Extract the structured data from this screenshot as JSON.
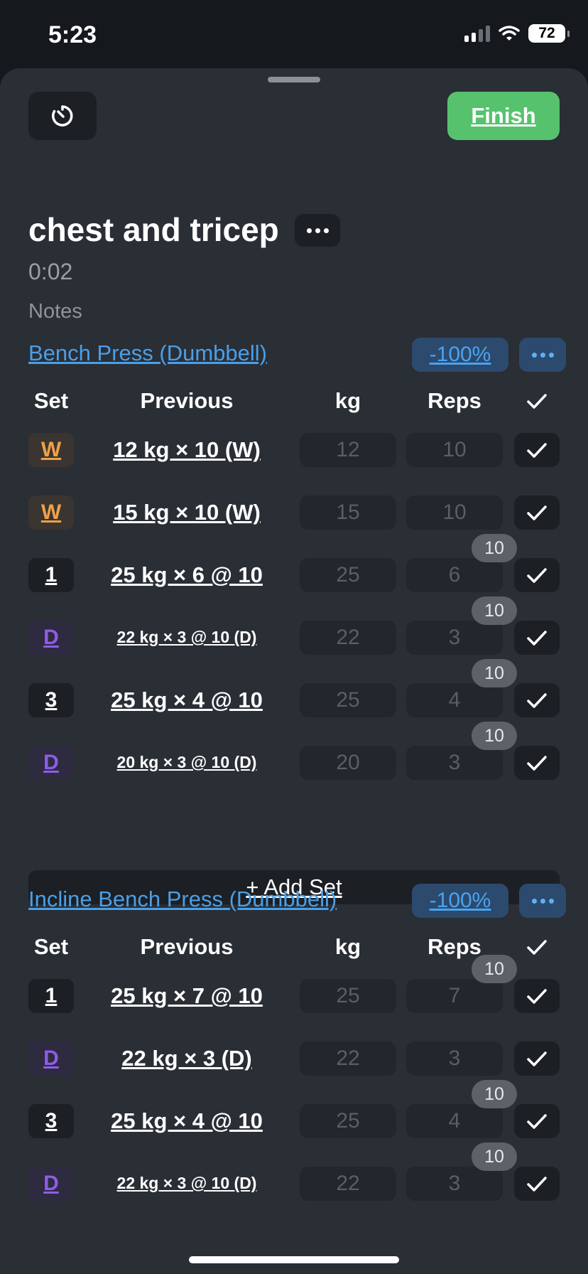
{
  "status_bar": {
    "time": "5:23",
    "battery": "72",
    "icons": [
      "signal-icon",
      "wifi-icon",
      "battery-icon"
    ]
  },
  "toolbar": {
    "timer_icon": "timer-icon",
    "finish_label": "Finish"
  },
  "workout": {
    "title": "chest and tricep",
    "elapsed": "0:02",
    "notes_placeholder": "Notes"
  },
  "columns": {
    "set": "Set",
    "previous": "Previous",
    "kg": "kg",
    "reps": "Reps"
  },
  "add_set_label": "+ Add Set",
  "exercises": [
    {
      "name": "Bench Press (Dumbbell)",
      "percent": "-100%",
      "sets": [
        {
          "set": "W",
          "type": "warmup",
          "previous": "12 kg × 10 (W)",
          "kg": "12",
          "reps": "10",
          "rpe": ""
        },
        {
          "set": "W",
          "type": "warmup",
          "previous": "15 kg × 10 (W)",
          "kg": "15",
          "reps": "10",
          "rpe": ""
        },
        {
          "set": "1",
          "type": "normal",
          "previous": "25 kg × 6 @ 10",
          "kg": "25",
          "reps": "6",
          "rpe": "10"
        },
        {
          "set": "D",
          "type": "drop",
          "previous": "22 kg × 3 @ 10 (D)",
          "kg": "22",
          "reps": "3",
          "rpe": "10"
        },
        {
          "set": "3",
          "type": "normal",
          "previous": "25 kg × 4 @ 10",
          "kg": "25",
          "reps": "4",
          "rpe": "10"
        },
        {
          "set": "D",
          "type": "drop",
          "previous": "20 kg × 3 @ 10 (D)",
          "kg": "20",
          "reps": "3",
          "rpe": "10"
        }
      ]
    },
    {
      "name": "Incline Bench Press (Dumbbell)",
      "percent": "-100%",
      "sets": [
        {
          "set": "1",
          "type": "normal",
          "previous": "25 kg × 7 @ 10",
          "kg": "25",
          "reps": "7",
          "rpe": "10"
        },
        {
          "set": "D",
          "type": "drop",
          "previous": "22 kg × 3 (D)",
          "kg": "22",
          "reps": "3",
          "rpe": ""
        },
        {
          "set": "3",
          "type": "normal",
          "previous": "25 kg × 4 @ 10",
          "kg": "25",
          "reps": "4",
          "rpe": "10"
        },
        {
          "set": "D",
          "type": "drop",
          "previous": "22 kg × 3 @ 10 (D)",
          "kg": "22",
          "reps": "3",
          "rpe": "10"
        }
      ]
    }
  ],
  "colors": {
    "sheet_bg": "#2a2e35",
    "finish_green": "#57c26e",
    "link_blue": "#4a9fe8",
    "warmup_orange": "#f0a04a",
    "drop_purple": "#8d5de8"
  }
}
